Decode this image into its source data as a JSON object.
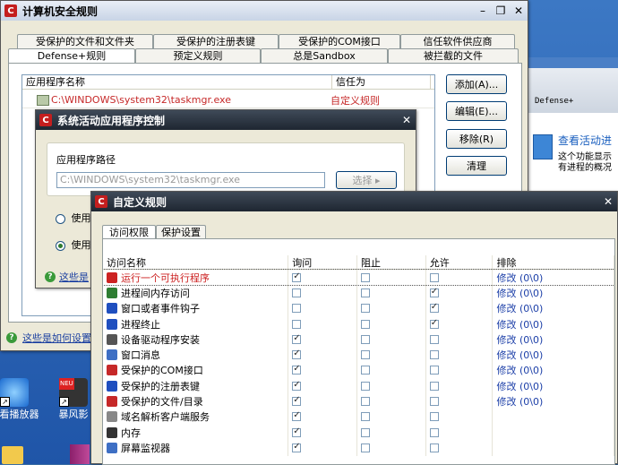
{
  "main_window": {
    "title": "计算机安全规则",
    "tabs_top": [
      "受保护的文件和文件夹",
      "受保护的注册表键",
      "受保护的COM接口",
      "信任软件供应商"
    ],
    "tabs_bottom": [
      "Defense+规则",
      "预定义规则",
      "总是Sandbox",
      "被拦截的文件"
    ],
    "columns": [
      "应用程序名称",
      "信任为"
    ],
    "row": {
      "app": "C:\\WINDOWS\\system32\\taskmgr.exe",
      "trust": "自定义规则"
    },
    "buttons": {
      "add": "添加(A)...",
      "edit": "编辑(E)...",
      "remove": "移除(R)",
      "purge": "清理"
    },
    "help_text": "这些是如何设置"
  },
  "right_window": {
    "header": "Defense+",
    "link": "查看活动进",
    "desc_line1": "这个功能显示",
    "desc_line2": "有进程的概况"
  },
  "dialog_active": {
    "title": "系统活动应用程序控制",
    "group_label": "应用程序路径",
    "path": "C:\\WINDOWS\\system32\\taskmgr.exe",
    "select_btn": "选择",
    "radio1": "使用",
    "radio2": "使用",
    "help_text": "这些是"
  },
  "dialog_custom": {
    "title": "自定义规则",
    "tabs": [
      "访问权限",
      "保护设置"
    ],
    "columns": [
      "访问名称",
      "询问",
      "阻止",
      "允许",
      "排除"
    ],
    "rows": [
      {
        "name": "运行一个可执行程序",
        "ask": true,
        "block": false,
        "allow": false,
        "exclude": "修改 (0\\0)",
        "color": "#cc2222"
      },
      {
        "name": "进程间内存访问",
        "ask": false,
        "block": false,
        "allow": true,
        "exclude": "修改 (0\\0)",
        "color": "#2e7d32"
      },
      {
        "name": "窗口或者事件钩子",
        "ask": false,
        "block": false,
        "allow": true,
        "exclude": "修改 (0\\0)",
        "color": "#1f4fbf"
      },
      {
        "name": "进程终止",
        "ask": false,
        "block": false,
        "allow": true,
        "exclude": "修改 (0\\0)",
        "color": "#1f4fbf"
      },
      {
        "name": "设备驱动程序安装",
        "ask": true,
        "block": false,
        "allow": false,
        "exclude": "修改 (0\\0)",
        "color": "#555555"
      },
      {
        "name": "窗口消息",
        "ask": true,
        "block": false,
        "allow": false,
        "exclude": "修改 (0\\0)",
        "color": "#3e6fc4"
      },
      {
        "name": "受保护的COM接口",
        "ask": true,
        "block": false,
        "allow": false,
        "exclude": "修改 (0\\0)",
        "color": "#c62828"
      },
      {
        "name": "受保护的注册表键",
        "ask": true,
        "block": false,
        "allow": false,
        "exclude": "修改 (0\\0)",
        "color": "#1f4fbf"
      },
      {
        "name": "受保护的文件/目录",
        "ask": true,
        "block": false,
        "allow": false,
        "exclude": "修改 (0\\0)",
        "color": "#c62828"
      },
      {
        "name": "域名解析客户端服务",
        "ask": true,
        "block": false,
        "allow": false,
        "exclude": "",
        "color": "#888888"
      },
      {
        "name": "内存",
        "ask": true,
        "block": false,
        "allow": false,
        "exclude": "",
        "color": "#333333"
      },
      {
        "name": "屏幕监视器",
        "ask": true,
        "block": false,
        "allow": false,
        "exclude": "",
        "color": "#3e6fc4"
      }
    ]
  },
  "desktop": {
    "icons": [
      {
        "label": "看看播放器"
      },
      {
        "label": "暴风影"
      }
    ],
    "badge": "NEU"
  }
}
